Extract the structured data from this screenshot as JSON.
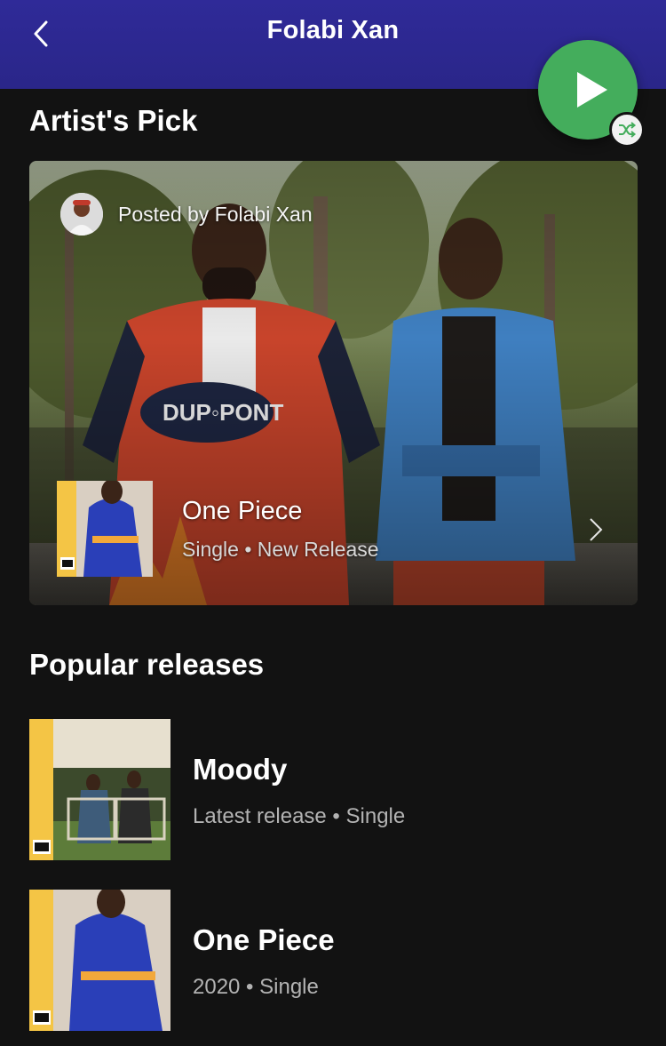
{
  "header": {
    "artist_name": "Folabi Xan",
    "back_icon": "chevron-left-icon"
  },
  "actions": {
    "play_icon": "play-icon",
    "shuffle_icon": "shuffle-icon",
    "accent_color": "#44ad5c"
  },
  "artist_pick": {
    "section_title": "Artist's Pick",
    "posted_by": "Posted by Folabi Xan",
    "release_title": "One Piece",
    "release_subtitle": "Single • New Release"
  },
  "popular_releases": {
    "section_title": "Popular releases",
    "items": [
      {
        "title": "Moody",
        "subtitle": "Latest release • Single"
      },
      {
        "title": "One Piece",
        "subtitle": "2020 • Single"
      }
    ]
  },
  "colors": {
    "header_bg": "#2f2a98",
    "page_bg": "#121212",
    "secondary_text": "#b3b3b3"
  }
}
